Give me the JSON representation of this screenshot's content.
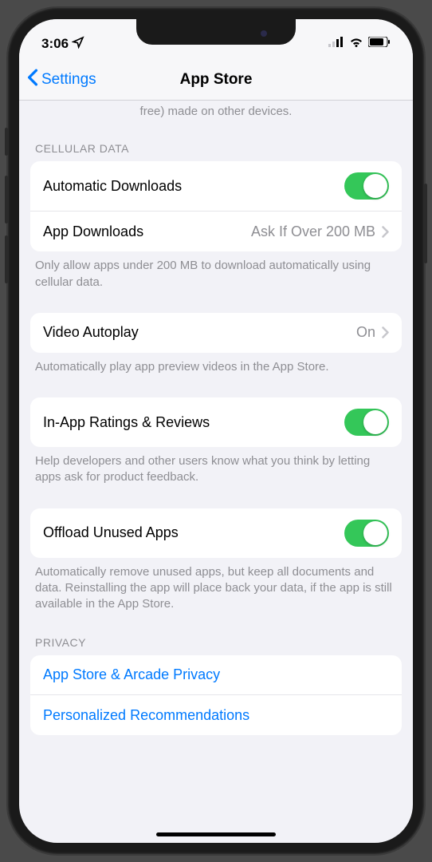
{
  "statusBar": {
    "time": "3:06"
  },
  "nav": {
    "backLabel": "Settings",
    "title": "App Store"
  },
  "topOverflowText": "free) made on other devices.",
  "sections": {
    "cellular": {
      "header": "CELLULAR DATA",
      "rows": {
        "autoDownloads": "Automatic Downloads",
        "appDownloads": "App Downloads",
        "appDownloadsValue": "Ask If Over 200 MB"
      },
      "footer": "Only allow apps under 200 MB to download automatically using cellular data."
    },
    "videoAutoplay": {
      "label": "Video Autoplay",
      "value": "On",
      "footer": "Automatically play app preview videos in the App Store."
    },
    "ratings": {
      "label": "In-App Ratings & Reviews",
      "footer": "Help developers and other users know what you think by letting apps ask for product feedback."
    },
    "offload": {
      "label": "Offload Unused Apps",
      "footer": "Automatically remove unused apps, but keep all documents and data. Reinstalling the app will place back your data, if the app is still available in the App Store."
    },
    "privacy": {
      "header": "PRIVACY",
      "rows": {
        "appStorePrivacy": "App Store & Arcade Privacy",
        "personalized": "Personalized Recommendations"
      }
    }
  }
}
